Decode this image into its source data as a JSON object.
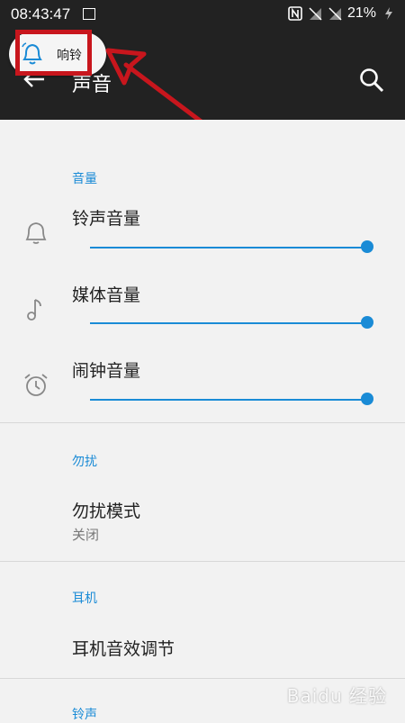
{
  "status_bar": {
    "time": "08:43:47",
    "battery": "21%"
  },
  "app_bar": {
    "title": "声音"
  },
  "toast": {
    "label": "响铃"
  },
  "sections": {
    "volume": {
      "heading": "音量",
      "ringtone": {
        "label": "铃声音量",
        "level": 100
      },
      "media": {
        "label": "媒体音量",
        "level": 100
      },
      "alarm": {
        "label": "闹钟音量",
        "level": 100
      }
    },
    "dnd": {
      "heading": "勿扰",
      "mode": {
        "label": "勿扰模式",
        "value": "关闭"
      }
    },
    "earphone": {
      "heading": "耳机",
      "eq": {
        "label": "耳机音效调节"
      }
    },
    "ringtone": {
      "heading": "铃声"
    }
  },
  "watermark": "Baidu 经验",
  "colors": {
    "accent": "#1a8bd6",
    "app_bar": "#222222",
    "annotation": "#c8161d"
  }
}
